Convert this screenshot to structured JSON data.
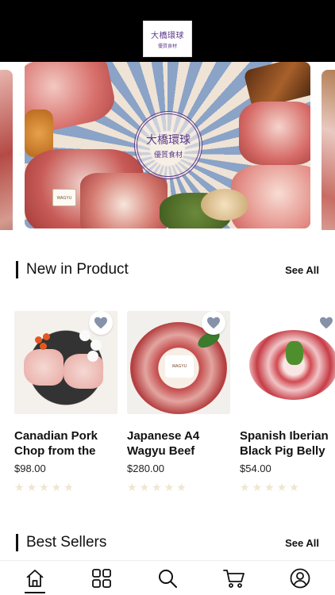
{
  "header": {
    "logo_line1": "大橋環球",
    "logo_line2": "優質食材"
  },
  "banner": {
    "seal_line1": "大橋環球",
    "seal_line2": "優質食材",
    "tag_text": "WAGYU"
  },
  "new_in_product": {
    "title": "New in Product",
    "see_all": "See All",
    "items": [
      {
        "name_line1": "Canadian Pork",
        "name_line2": "Chop from the",
        "price": "$98.00",
        "rating": 0,
        "image_icon": "pork-chop-icon"
      },
      {
        "name_line1": "Japanese A4",
        "name_line2": "Wagyu Beef",
        "price": "$280.00",
        "rating": 0,
        "image_icon": "wagyu-beef-icon",
        "label_text": "WAGYU"
      },
      {
        "name_line1": "Spanish Iberian",
        "name_line2": "Black Pig Belly",
        "price": "$54.00",
        "rating": 0,
        "image_icon": "iberian-pork-icon"
      }
    ]
  },
  "best_sellers": {
    "title": "Best Sellers",
    "see_all": "See All"
  },
  "tabbar": {
    "items": [
      {
        "icon": "home-icon",
        "active": true
      },
      {
        "icon": "categories-icon",
        "active": false
      },
      {
        "icon": "search-icon",
        "active": false
      },
      {
        "icon": "cart-icon",
        "active": false
      },
      {
        "icon": "profile-icon",
        "active": false
      }
    ]
  },
  "colors": {
    "accent": "#111111",
    "star_empty": "#f0e5cf",
    "favorite_icon": "#8592a8",
    "brand_purple": "#5b3a8a"
  }
}
